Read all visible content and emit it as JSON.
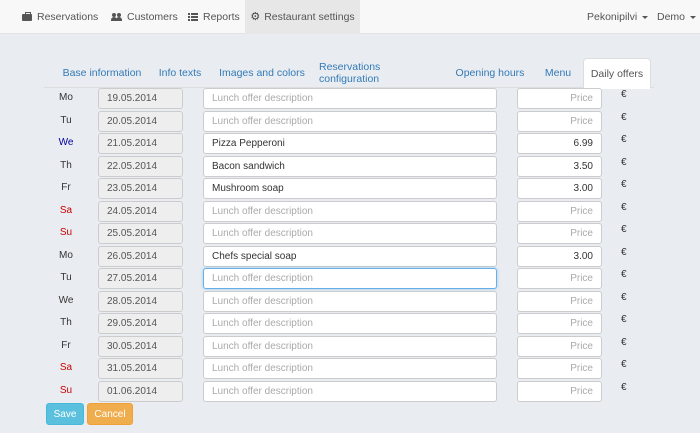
{
  "navbar": {
    "items": [
      {
        "label": "Reservations",
        "icon": "reservations-icon"
      },
      {
        "label": "Customers",
        "icon": "users-icon"
      },
      {
        "label": "Reports",
        "icon": "list-icon"
      },
      {
        "label": "Restaurant settings",
        "icon": "gear-icon"
      }
    ],
    "active_index": 3,
    "restaurant_menu": "Pekonipilvi",
    "user_menu": "Demo"
  },
  "tabs": {
    "items": [
      "Base information",
      "Info texts",
      "Images and colors",
      "Reservations configuration",
      "Opening hours",
      "Menu",
      "Daily offers"
    ],
    "active_index": 6
  },
  "form": {
    "description_placeholder": "Lunch offer description",
    "price_placeholder": "Price",
    "currency": "€",
    "focused_row_index": 8
  },
  "day_colors": {
    "weekday": "#333333",
    "today": "#000099",
    "weekend": "#cc0000"
  },
  "offers": [
    {
      "day": "Mo",
      "date": "19.05.2014",
      "description": "",
      "price": "",
      "day_color": "#333333"
    },
    {
      "day": "Tu",
      "date": "20.05.2014",
      "description": "",
      "price": "",
      "day_color": "#333333"
    },
    {
      "day": "We",
      "date": "21.05.2014",
      "description": "Pizza Pepperoni",
      "price": "6.99",
      "day_color": "#000099"
    },
    {
      "day": "Th",
      "date": "22.05.2014",
      "description": "Bacon sandwich",
      "price": "3.50",
      "day_color": "#333333"
    },
    {
      "day": "Fr",
      "date": "23.05.2014",
      "description": "Mushroom soap",
      "price": "3.00",
      "day_color": "#333333"
    },
    {
      "day": "Sa",
      "date": "24.05.2014",
      "description": "",
      "price": "",
      "day_color": "#cc0000"
    },
    {
      "day": "Su",
      "date": "25.05.2014",
      "description": "",
      "price": "",
      "day_color": "#cc0000"
    },
    {
      "day": "Mo",
      "date": "26.05.2014",
      "description": "Chefs special soap",
      "price": "3.00",
      "day_color": "#333333"
    },
    {
      "day": "Tu",
      "date": "27.05.2014",
      "description": "",
      "price": "",
      "day_color": "#333333"
    },
    {
      "day": "We",
      "date": "28.05.2014",
      "description": "",
      "price": "",
      "day_color": "#333333"
    },
    {
      "day": "Th",
      "date": "29.05.2014",
      "description": "",
      "price": "",
      "day_color": "#333333"
    },
    {
      "day": "Fr",
      "date": "30.05.2014",
      "description": "",
      "price": "",
      "day_color": "#333333"
    },
    {
      "day": "Sa",
      "date": "31.05.2014",
      "description": "",
      "price": "",
      "day_color": "#cc0000"
    },
    {
      "day": "Su",
      "date": "01.06.2014",
      "description": "",
      "price": "",
      "day_color": "#cc0000"
    }
  ],
  "buttons": {
    "save": "Save",
    "cancel": "Cancel"
  }
}
